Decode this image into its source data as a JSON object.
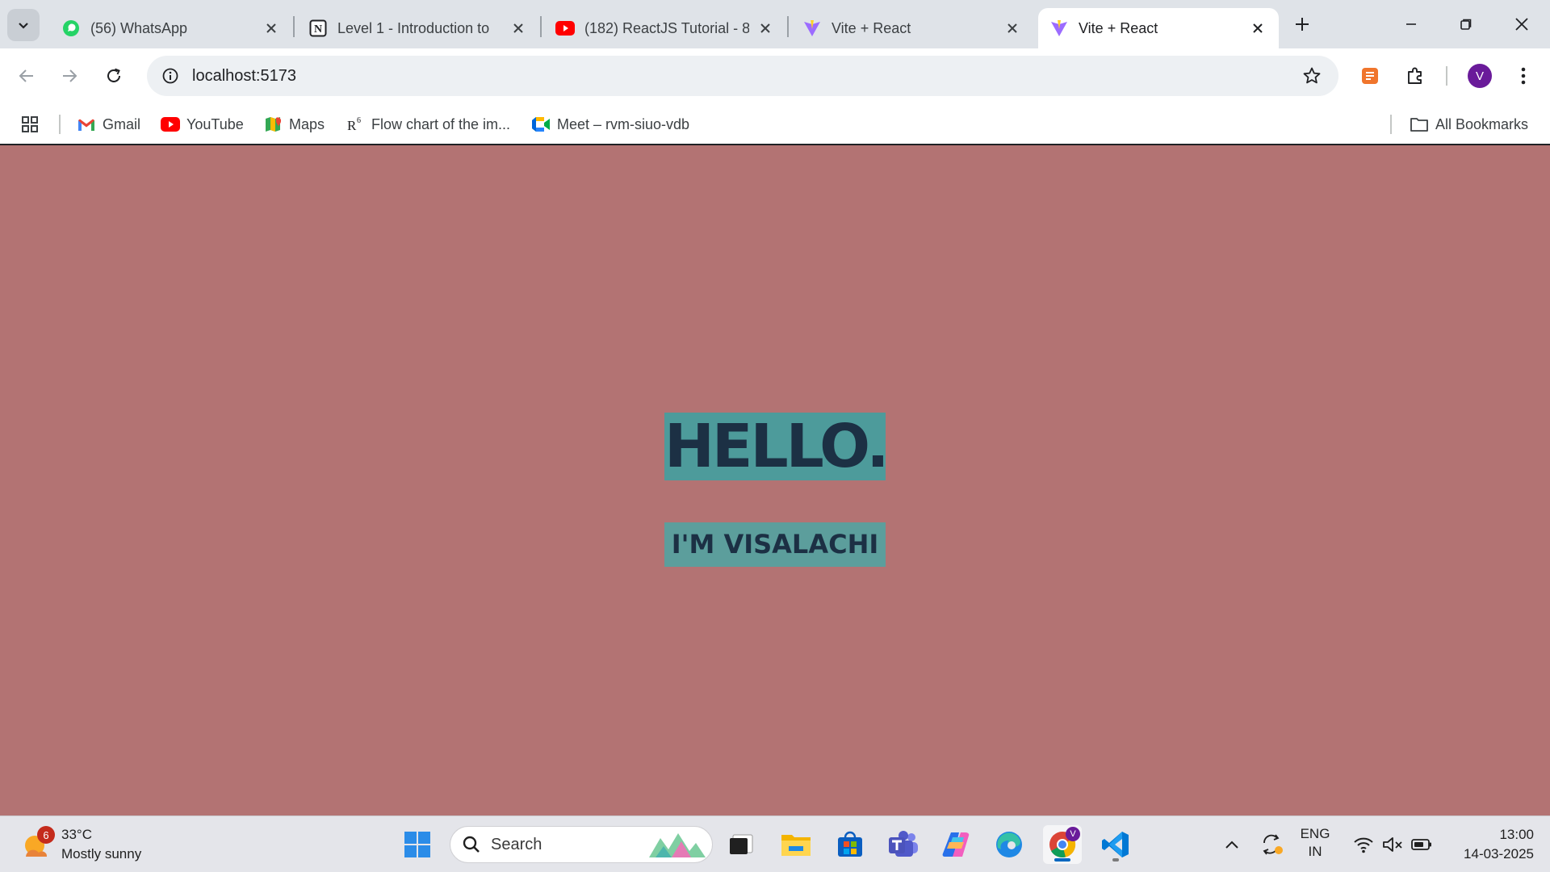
{
  "browser": {
    "tabs": [
      {
        "title": "(56) WhatsApp",
        "icon": "whatsapp-icon"
      },
      {
        "title": "Level 1 - Introduction to",
        "icon": "notion-icon"
      },
      {
        "title": "(182) ReactJS Tutorial - 8",
        "icon": "youtube-icon"
      },
      {
        "title": "Vite + React",
        "icon": "vite-icon"
      },
      {
        "title": "Vite + React",
        "icon": "vite-icon",
        "active": true
      }
    ],
    "address_bar": {
      "url": "localhost:5173"
    },
    "profile_initial": "V",
    "bookmarks": [
      {
        "label": "Gmail",
        "icon": "gmail-icon"
      },
      {
        "label": "YouTube",
        "icon": "youtube-icon"
      },
      {
        "label": "Maps",
        "icon": "maps-icon"
      },
      {
        "label": "Flow chart of the im...",
        "icon": "r6-icon"
      },
      {
        "label": "Meet – rvm-siuo-vdb",
        "icon": "meet-icon"
      }
    ],
    "all_bookmarks_label": "All Bookmarks"
  },
  "page": {
    "heading": "HELLO..",
    "subheading": "I'M VISALACHI",
    "colors": {
      "background": "#b37373",
      "text_bg": "#4d9b9b",
      "text": "#1c3044"
    }
  },
  "taskbar": {
    "weather": {
      "badge": "6",
      "temperature": "33°C",
      "condition": "Mostly sunny"
    },
    "search_label": "Search",
    "chrome_badge": "V",
    "language": {
      "line1": "ENG",
      "line2": "IN"
    },
    "clock": {
      "time": "13:00",
      "date": "14-03-2025"
    }
  }
}
